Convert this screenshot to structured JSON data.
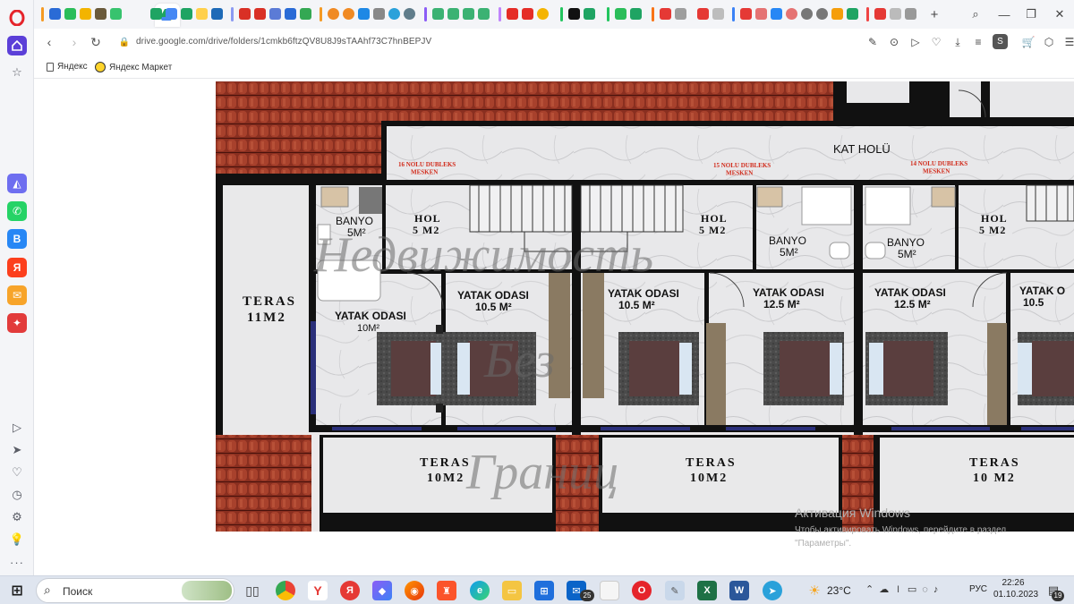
{
  "browser": {
    "url": "drive.google.com/drive/folders/1cmkb6ftzQV8U8J9sTAAhf73C7hnBEPJV",
    "bookmarks": [
      {
        "label": "Яндекс"
      },
      {
        "label": "Яндекс Маркет"
      }
    ],
    "profile_initial": "S"
  },
  "floorplan": {
    "header_labels": {
      "hall": "KAT HOLÜ",
      "unit16": "16 NOLU DUBLEKS\nMESKEN",
      "unit15": "15 NOLU DUBLEKS\nMESKEN",
      "unit14": "14 NOLU DUBLEKS\nMESKEN"
    },
    "rooms": {
      "teras_left_title": "TERAS",
      "teras_left_area": "11M2",
      "banyo_1_title": "BANYO",
      "banyo_1_area": "5M²",
      "hol_1_title": "HOL",
      "hol_1_area": "5 M2",
      "hol_2_title": "HOL",
      "hol_2_area": "5 M2",
      "banyo_2_title": "BANYO",
      "banyo_2_area": "5M²",
      "banyo_3_title": "BANYO",
      "banyo_3_area": "5M²",
      "hol_3_title": "HOL",
      "hol_3_area": "5 M2",
      "yatak_1_title": "YATAK ODASI",
      "yatak_1_area": "10M²",
      "yatak_2_title": "YATAK ODASI",
      "yatak_2_area": "10.5 M²",
      "yatak_3_title": "YATAK ODASI",
      "yatak_3_area": "10.5 M²",
      "yatak_4_title": "YATAK ODASI",
      "yatak_4_area": "12.5 M²",
      "yatak_5_title": "YATAK ODASI",
      "yatak_5_area": "12.5 M²",
      "yatak_6_title": "YATAK O",
      "yatak_6_area": "10.5",
      "teras_b1_title": "TERAS",
      "teras_b1_area": "10M2",
      "teras_b2_title": "TERAS",
      "teras_b2_area": "10M2",
      "teras_b3_title": "TERAS",
      "teras_b3_area": "10 M2"
    },
    "watermark_lines": [
      "Недвижимость",
      "Без",
      "Границ"
    ]
  },
  "activation": {
    "title": "Активация Windows",
    "subtitle": "Чтобы активировать Windows, перейдите в раздел \"Параметры\"."
  },
  "taskbar": {
    "search_placeholder": "Поиск",
    "mail_badge": "25",
    "weather": "23°C",
    "language": "РУС",
    "time": "22:26",
    "date": "01.10.2023",
    "notification_count": "19"
  }
}
